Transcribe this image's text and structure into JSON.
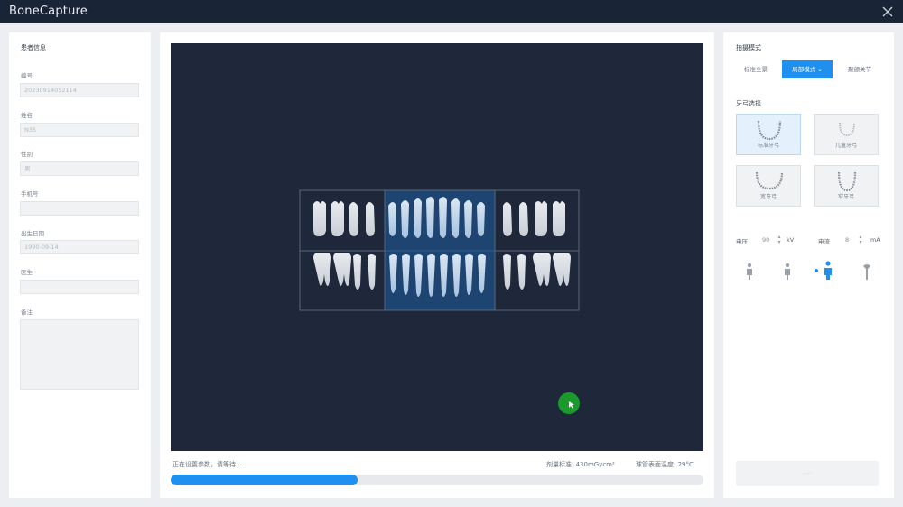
{
  "app": {
    "title": "BoneCapture"
  },
  "patient": {
    "section_title": "患者信息",
    "fields": [
      {
        "label": "编号",
        "value": "20230914052114"
      },
      {
        "label": "姓名",
        "value": "N35"
      },
      {
        "label": "性别",
        "value": "男"
      },
      {
        "label": "手机号",
        "value": ""
      },
      {
        "label": "出生日期",
        "value": "1990-09-14"
      },
      {
        "label": "医生",
        "value": ""
      },
      {
        "label": "备注",
        "value": ""
      }
    ]
  },
  "viewer": {
    "status": "正在设置参数，请等待…",
    "dose": "剂量标准: 430mGycm²",
    "temperature": "球管表面温度: 29°C",
    "progress": 0.35
  },
  "shoot": {
    "section_title": "拍摄模式",
    "modes": [
      "标准全景",
      "局部模式 ⌄",
      "颞颌关节"
    ],
    "active_mode_index": 1,
    "arch_section_title": "牙弓选择",
    "arches": [
      {
        "label": "标准牙弓",
        "icon": "standard-arch-icon"
      },
      {
        "label": "儿童牙弓",
        "icon": "child-arch-icon"
      },
      {
        "label": "宽牙弓",
        "icon": "wide-arch-icon"
      },
      {
        "label": "窄牙弓",
        "icon": "narrow-arch-icon"
      }
    ],
    "selected_arch_index": 0,
    "voltage_label": "电压",
    "voltage_value": "90",
    "voltage_unit": "kV",
    "current_label": "电流",
    "current_value": "8",
    "current_unit": "mA",
    "action_label": "····"
  },
  "colors": {
    "titlebar": "#1a2437",
    "viewport": "#1e283a",
    "accent": "#1f8ff0",
    "selected_region": "#1f4a7d",
    "cursor_marker": "#1a9a2a"
  }
}
